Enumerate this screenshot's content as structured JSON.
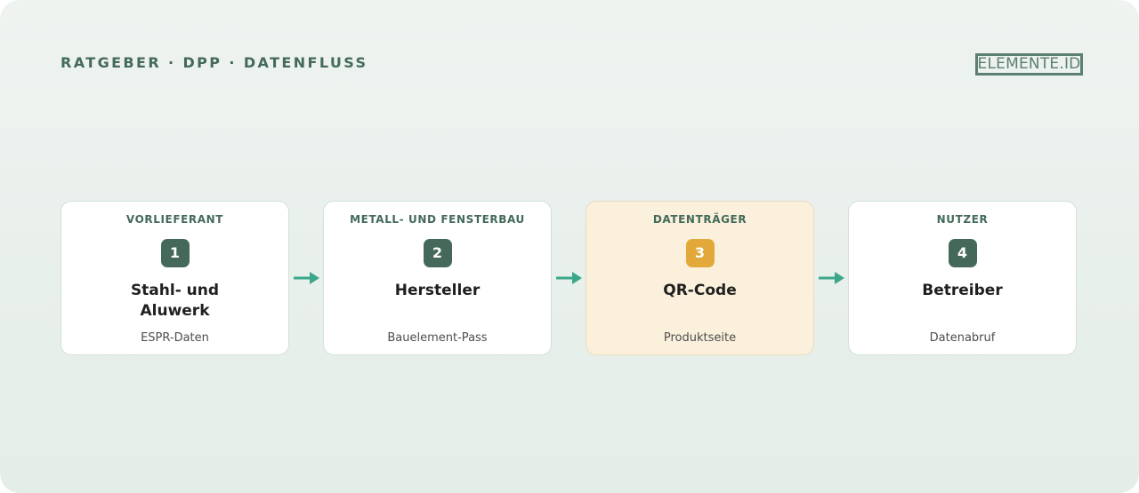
{
  "header": {
    "breadcrumb": "RATGEBER · DPP · DATENFLUSS",
    "logo_text": "ELEMENTE.ID"
  },
  "colors": {
    "accent_green": "#44695a",
    "accent_orange": "#e2a93a",
    "arrow_teal": "#3aa78a",
    "highlight_bg": "#fbf0dc"
  },
  "steps": [
    {
      "category": "VORLIEFERANT",
      "number": "1",
      "title": "Stahl- und Aluwerk",
      "subtitle": "ESPR-Daten"
    },
    {
      "category": "METALL- UND FENSTERBAU",
      "number": "2",
      "title": "Hersteller",
      "subtitle": "Bauelement-Pass"
    },
    {
      "category": "DATENTRÄGER",
      "number": "3",
      "title": "QR-Code",
      "subtitle": "Produktseite"
    },
    {
      "category": "NUTZER",
      "number": "4",
      "title": "Betreiber",
      "subtitle": "Datenabruf"
    }
  ]
}
